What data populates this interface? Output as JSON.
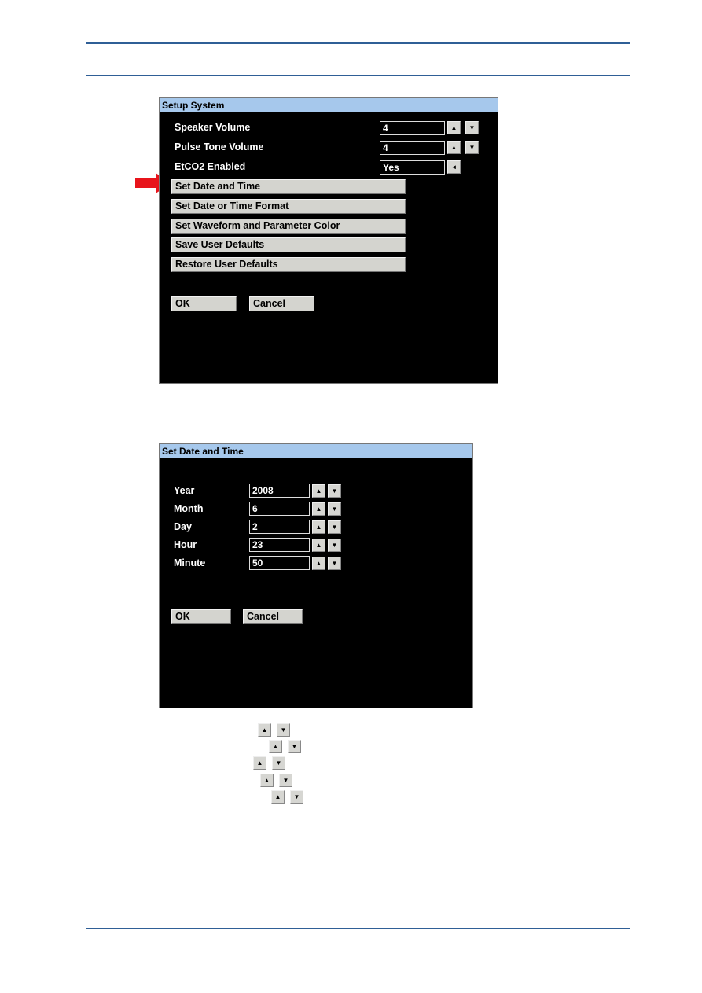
{
  "setup_system": {
    "title": "Setup System",
    "settings": [
      {
        "label": "Speaker Volume",
        "value": "4",
        "controls": [
          "up",
          "down"
        ]
      },
      {
        "label": "Pulse Tone Volume",
        "value": "4",
        "controls": [
          "up",
          "down"
        ]
      },
      {
        "label": "EtCO2 Enabled",
        "value": "Yes",
        "controls": [
          "left"
        ]
      }
    ],
    "menu_buttons": [
      "Set Date and Time",
      "Set Date or Time Format",
      "Set Waveform and Parameter Color",
      "Save User Defaults",
      "Restore User Defaults"
    ],
    "ok_label": "OK",
    "cancel_label": "Cancel",
    "highlight_arrow_color": "#e8141b"
  },
  "set_date_time": {
    "title": "Set Date and Time",
    "fields": [
      {
        "label": "Year",
        "value": "2008"
      },
      {
        "label": "Month",
        "value": "6"
      },
      {
        "label": "Day",
        "value": "2"
      },
      {
        "label": "Hour",
        "value": "23"
      },
      {
        "label": "Minute",
        "value": "50"
      }
    ],
    "ok_label": "OK",
    "cancel_label": "Cancel"
  },
  "icons": {
    "up": "▲",
    "down": "▼",
    "left": "◄"
  },
  "colors": {
    "title_bar": "#a6c8ec",
    "dialog_bg": "#000000",
    "button_bg": "#d4d4cf",
    "rule": "#2f5f96"
  }
}
